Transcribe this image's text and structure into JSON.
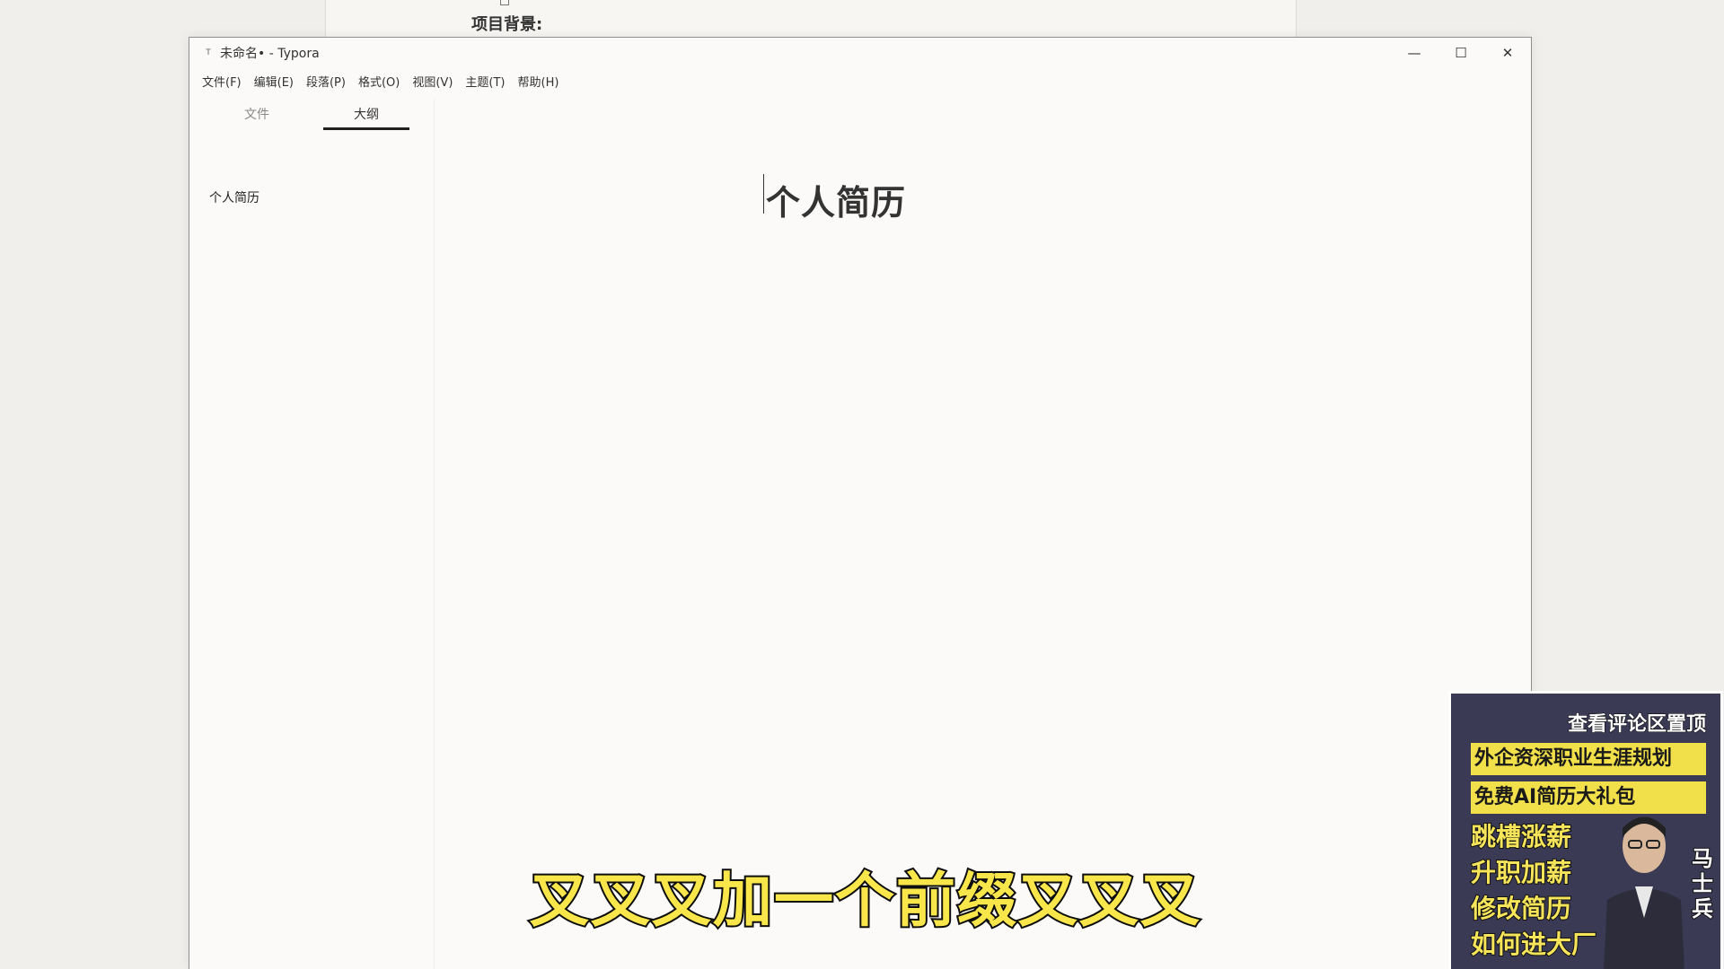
{
  "background_doc": {
    "heading": "项目背景:"
  },
  "window": {
    "title": "未命名• - Typora",
    "app_icon": "Typora-icon",
    "controls": {
      "minimize": "—",
      "maximize": "☐",
      "close": "✕"
    }
  },
  "menu": {
    "items": [
      "文件(F)",
      "编辑(E)",
      "段落(P)",
      "格式(O)",
      "视图(V)",
      "主题(T)",
      "帮助(H)"
    ]
  },
  "sidebar": {
    "tabs": {
      "files": "文件",
      "outline": "大纲"
    },
    "active_tab": "大纲",
    "outline_items": [
      "个人简历"
    ]
  },
  "editor": {
    "heading": "个人简历"
  },
  "subtitle": "叉叉叉加一个前缀叉叉叉",
  "ad": {
    "top_text": "查看评论区置顶",
    "banner_1": "外企资深职业生涯规划",
    "banner_2": "免费AI简历大礼包",
    "lines": [
      "跳槽涨薪",
      "升职加薪",
      "修改简历",
      "如何进大厂"
    ],
    "name": "马士兵"
  },
  "colors": {
    "subtitle_fill": "#f9e64b",
    "subtitle_stroke": "#111111",
    "ad_background": "#3b3a55",
    "ad_banner": "#f1e04a",
    "active_tab_underline": "#1f1f1f"
  }
}
